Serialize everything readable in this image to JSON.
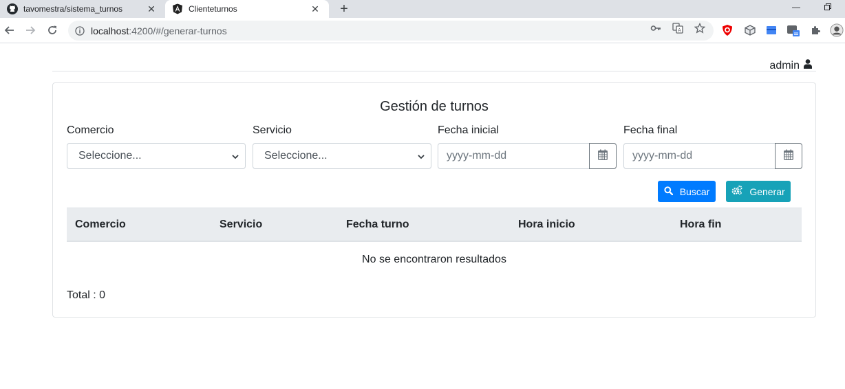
{
  "browser": {
    "tabs": [
      {
        "title": "tavomestra/sistema_turnos",
        "favicon": "github-icon",
        "active": false
      },
      {
        "title": "Clienteturnos",
        "favicon": "angular-icon",
        "active": true
      }
    ],
    "url_host": "localhost",
    "url_rest": ":4200/#/generar-turnos"
  },
  "header": {
    "user": "admin"
  },
  "card": {
    "title": "Gestión de turnos",
    "filters": {
      "comercio_label": "Comercio",
      "comercio_value": "Seleccione...",
      "servicio_label": "Servicio",
      "servicio_value": "Seleccione...",
      "fecha_inicial_label": "Fecha inicial",
      "fecha_inicial_placeholder": "yyyy-mm-dd",
      "fecha_final_label": "Fecha final",
      "fecha_final_placeholder": "yyyy-mm-dd"
    },
    "buttons": {
      "buscar": "Buscar",
      "generar": "Generar"
    },
    "table": {
      "columns": [
        "Comercio",
        "Servicio",
        "Fecha turno",
        "Hora inicio",
        "Hora fin"
      ],
      "empty_message": "No se encontraron resultados"
    },
    "total_text": "Total : 0"
  },
  "colors": {
    "primary": "#007bff",
    "info": "#17a2b8",
    "table_header": "#e9ecef"
  }
}
